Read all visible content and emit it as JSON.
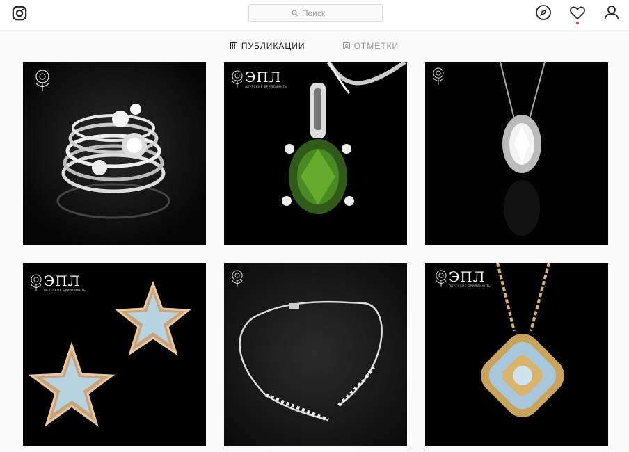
{
  "header": {
    "logo_icon": "instagram-camera-icon",
    "search": {
      "placeholder": "Поиск",
      "icon": "search-icon"
    },
    "nav_icons": [
      "compass-icon",
      "heart-icon",
      "user-icon"
    ],
    "notification_dot_color": "#ed4956"
  },
  "tabs": [
    {
      "label": "ПУБЛИКАЦИИ",
      "icon": "grid-icon",
      "active": true
    },
    {
      "label": "ОТМЕТКИ",
      "icon": "tagged-icon",
      "active": false
    }
  ],
  "posts": [
    {
      "subject": "stacked diamond rings",
      "brand_logo": "flower-icon"
    },
    {
      "subject": "green gemstone pendant",
      "brand_logo": "flower-icon",
      "brand_text": "ЭПЛ",
      "brand_sub": "ЯКУТСКИЕ БРИЛЛИАНТЫ"
    },
    {
      "subject": "marquise diamond pendant",
      "brand_logo": "flower-icon"
    },
    {
      "subject": "star diamond earrings",
      "brand_logo": "flower-icon",
      "brand_text": "ЭПЛ",
      "brand_sub": "ЯКУТСКИЕ БРИЛЛИАНТЫ"
    },
    {
      "subject": "diamond collar necklace",
      "brand_logo": "flower-icon"
    },
    {
      "subject": "cushion diamond pendant",
      "brand_logo": "flower-icon",
      "brand_text": "ЭПЛ",
      "brand_sub": "ЯКУТСКИЕ БРИЛЛИАНТЫ"
    }
  ]
}
